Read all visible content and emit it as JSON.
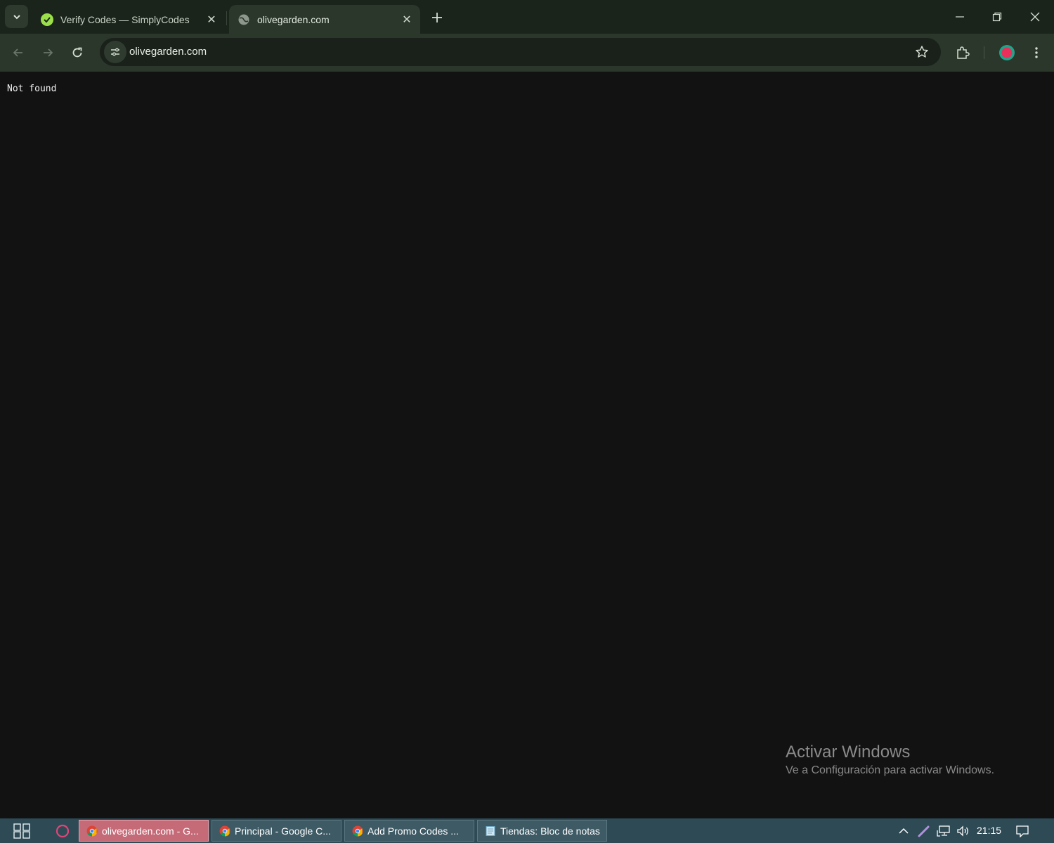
{
  "browser": {
    "tabs": [
      {
        "title": "Verify Codes — SimplyCodes",
        "active": false,
        "favicon": "simplycodes-logo-icon"
      },
      {
        "title": "olivegarden.com",
        "active": true,
        "favicon": "globe-icon"
      }
    ],
    "address": "olivegarden.com",
    "accent": "#2b372b"
  },
  "page": {
    "message": "Not found"
  },
  "watermark": {
    "title": "Activar Windows",
    "subtitle": "Ve a Configuración para activar Windows."
  },
  "taskbar": {
    "items": [
      {
        "label": "olivegarden.com - G...",
        "active": true,
        "icon": "chrome-icon"
      },
      {
        "label": "Principal - Google C...",
        "active": false,
        "icon": "chrome-icon"
      },
      {
        "label": "Add Promo Codes ...",
        "active": false,
        "icon": "chrome-icon"
      },
      {
        "label": "Tiendas: Bloc de notas",
        "active": false,
        "icon": "notepad-icon"
      }
    ],
    "time": "21:15"
  }
}
